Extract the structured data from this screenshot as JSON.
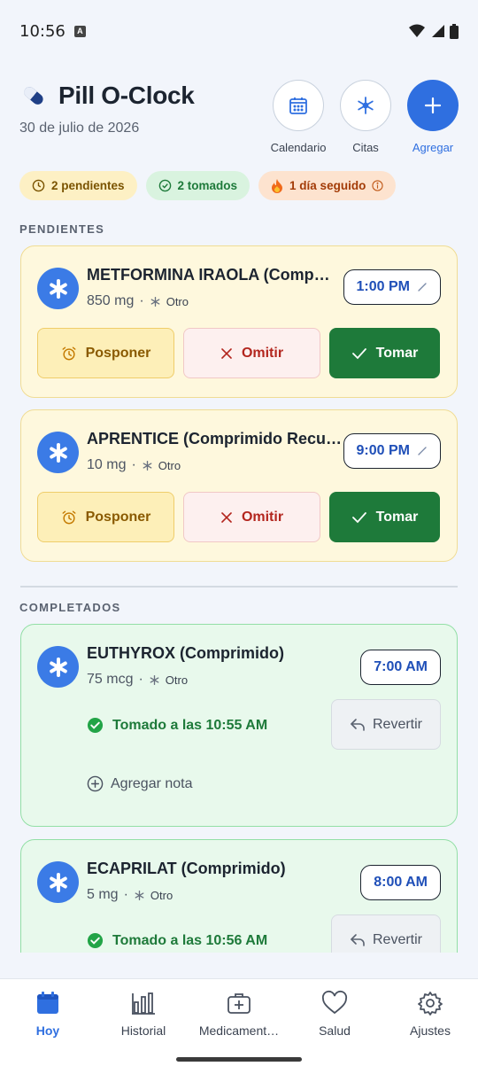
{
  "status_bar": {
    "time": "10:56",
    "notif_letter": "A"
  },
  "header": {
    "title": "Pill O-Clock",
    "date": "30 de julio de 2026",
    "actions": [
      {
        "label": "Calendario",
        "icon": "calendar-icon"
      },
      {
        "label": "Citas",
        "icon": "medical-star-icon"
      },
      {
        "label": "Agregar",
        "icon": "plus-icon"
      }
    ]
  },
  "chips": {
    "pending": "2 pendientes",
    "taken": "2 tomados",
    "streak": "1 día seguido"
  },
  "sections": {
    "pending": "PENDIENTES",
    "completed": "COMPLETADOS"
  },
  "pending": [
    {
      "name": "METFORMINA IRAOLA (Comprimido)",
      "dose": "850 mg",
      "category": "Otro",
      "time": "1:00 PM"
    },
    {
      "name": "APRENTICE (Comprimido Recubierto)",
      "dose": "10 mg",
      "category": "Otro",
      "time": "9:00 PM"
    }
  ],
  "pending_actions": {
    "snooze": "Posponer",
    "skip": "Omitir",
    "take": "Tomar"
  },
  "completed": [
    {
      "name": "EUTHYROX (Comprimido)",
      "dose": "75 mcg",
      "category": "Otro",
      "time": "7:00 AM",
      "taken": "Tomado a las 10:55 AM",
      "revert": "Revertir",
      "note": "Agregar nota"
    },
    {
      "name": "ECAPRILAT (Comprimido)",
      "dose": "5 mg",
      "category": "Otro",
      "time": "8:00 AM",
      "taken": "Tomado a las 10:56 AM",
      "revert": "Revertir"
    }
  ],
  "bottom_nav": [
    {
      "label": "Hoy",
      "active": true
    },
    {
      "label": "Historial"
    },
    {
      "label": "Medicament…"
    },
    {
      "label": "Salud"
    },
    {
      "label": "Ajustes"
    }
  ],
  "colors": {
    "primary": "#2f6fe0",
    "success": "#1e7a3a",
    "danger": "#b3261e",
    "warning": "#8a5a00"
  }
}
